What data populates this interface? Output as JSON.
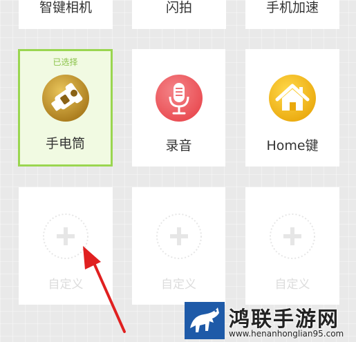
{
  "top_row": [
    {
      "label": "智键相机"
    },
    {
      "label": "闪拍"
    },
    {
      "label": "手机加速"
    }
  ],
  "features": [
    {
      "label": "手电筒",
      "badge": "已选择",
      "icon": "flashlight-icon",
      "selected": true
    },
    {
      "label": "录音",
      "icon": "microphone-icon",
      "selected": false
    },
    {
      "label": "Home键",
      "icon": "home-icon",
      "selected": false
    }
  ],
  "custom_slots": [
    {
      "label": "自定义",
      "icon": "plus-icon"
    },
    {
      "label": "自定义",
      "icon": "plus-icon"
    },
    {
      "label": "自定义",
      "icon": "plus-icon"
    }
  ],
  "watermark": {
    "title": "鸿联手游网",
    "url": "www.henanhonglian95.com"
  },
  "colors": {
    "selected_border": "#9ad650",
    "selected_background": "#f1fae2",
    "badge_text": "#8bc34a",
    "arrow": "#e02020",
    "flashlight_gold": "#c99a2a",
    "microphone_red": "#ee5a5f",
    "home_yellow": "#f4be1a"
  }
}
